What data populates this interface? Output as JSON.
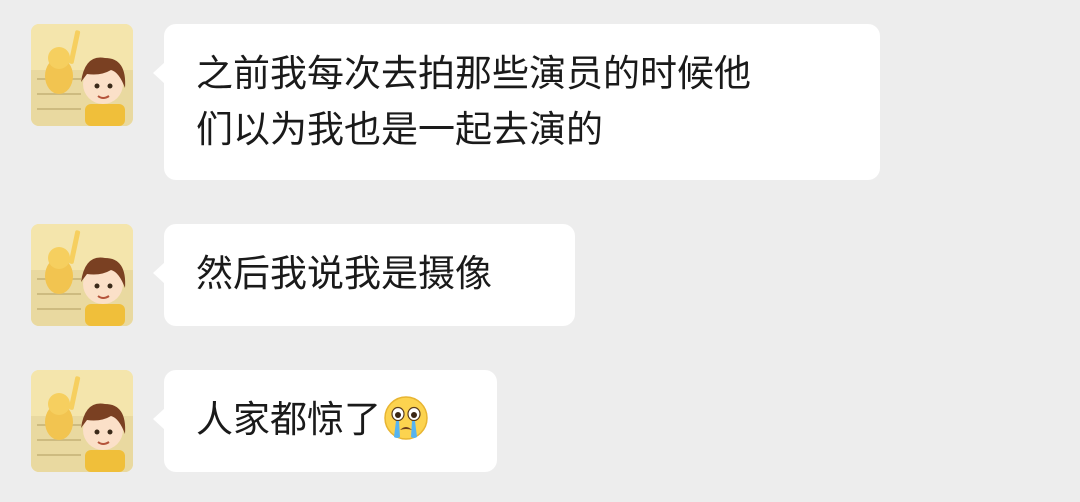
{
  "chat": {
    "messages": [
      {
        "text": "之前我每次去拍那些演员的时候他\n们以为我也是一起去演的",
        "emoji": ""
      },
      {
        "text": "然后我说我是摄像",
        "emoji": ""
      },
      {
        "text": "人家都惊了",
        "emoji": "loudly-crying-face"
      }
    ]
  },
  "colors": {
    "background": "#ededed",
    "bubble": "#ffffff",
    "text": "#1a1a1a"
  }
}
